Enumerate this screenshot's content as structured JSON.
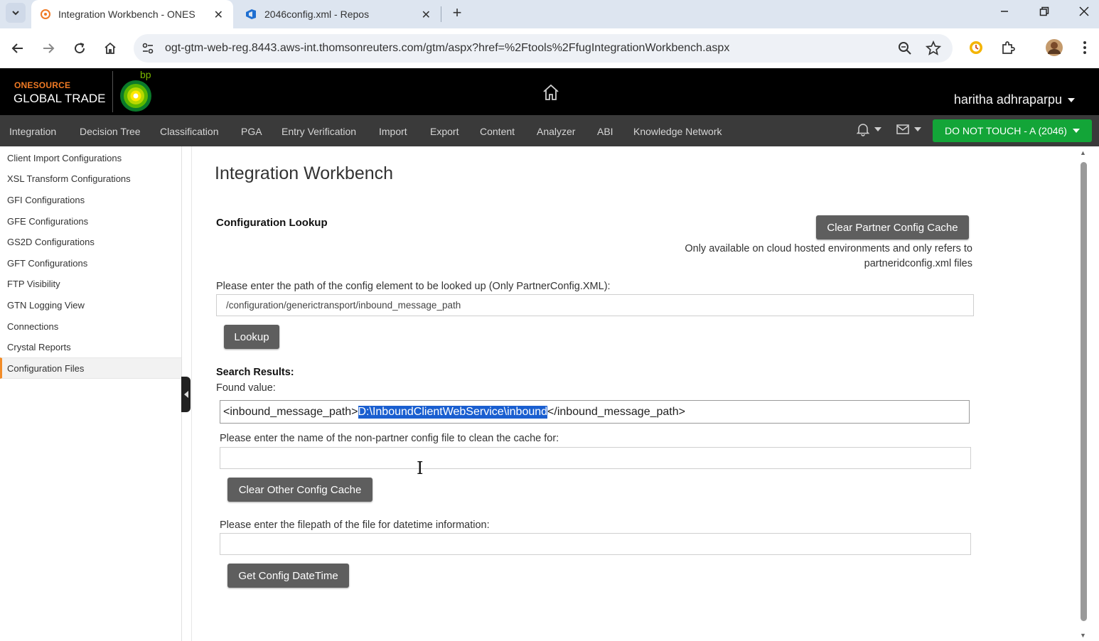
{
  "browser": {
    "tabs": [
      {
        "title": "Integration Workbench - ONES",
        "active": true
      },
      {
        "title": "2046config.xml - Repos",
        "active": false
      }
    ],
    "url": "ogt-gtm-web-reg.8443.aws-int.thomsonreuters.com/gtm/aspx?href=%2Ftools%2FfugIntegrationWorkbench.aspx"
  },
  "header": {
    "logo_top": "ONESOURCE",
    "logo_main": "GLOBAL TRADE",
    "partner_logo": "bp",
    "user_name": "haritha adhraparpu"
  },
  "nav": {
    "items": [
      "Integration",
      "Decision Tree",
      "Classification",
      "PGA",
      "Entry Verification",
      "Import",
      "Export",
      "Content",
      "Analyzer",
      "ABI",
      "Knowledge Network"
    ],
    "environment": "DO NOT TOUCH - A (2046)",
    "environment_color": "#13a538"
  },
  "sidebar": {
    "items": [
      {
        "label": "Client Import Configurations"
      },
      {
        "label": "XSL Transform Configurations"
      },
      {
        "label": "GFI Configurations"
      },
      {
        "label": "GFE Configurations"
      },
      {
        "label": "GS2D Configurations"
      },
      {
        "label": "GFT Configurations"
      },
      {
        "label": "FTP Visibility"
      },
      {
        "label": "GTN Logging View"
      },
      {
        "label": "Connections"
      },
      {
        "label": "Crystal Reports"
      },
      {
        "label": "Configuration Files",
        "selected": true
      }
    ]
  },
  "main": {
    "title": "Integration Workbench",
    "section_title": "Configuration Lookup",
    "clear_partner_button": "Clear Partner Config Cache",
    "note_line1": "Only available on cloud hosted environments and only refers to",
    "note_line2": "partneridconfig.xml files",
    "lookup_label": "Please enter the path of the config element to be looked up (Only PartnerConfig.XML):",
    "lookup_value": "/configuration/generictransport/inbound_message_path",
    "lookup_button": "Lookup",
    "results_title": "Search Results:",
    "found_label": "Found value:",
    "found_prefix": "<inbound_message_path>",
    "found_highlight": "D:\\InboundClientWebService\\inbound",
    "found_suffix": "</inbound_message_path>",
    "nonpartner_label": "Please enter the name of the non-partner config file to clean the cache for:",
    "nonpartner_value": "",
    "clear_other_button": "Clear Other Config Cache",
    "datetime_label": "Please enter the filepath of the file for datetime information:",
    "datetime_value": "",
    "datetime_button": "Get Config DateTime"
  }
}
